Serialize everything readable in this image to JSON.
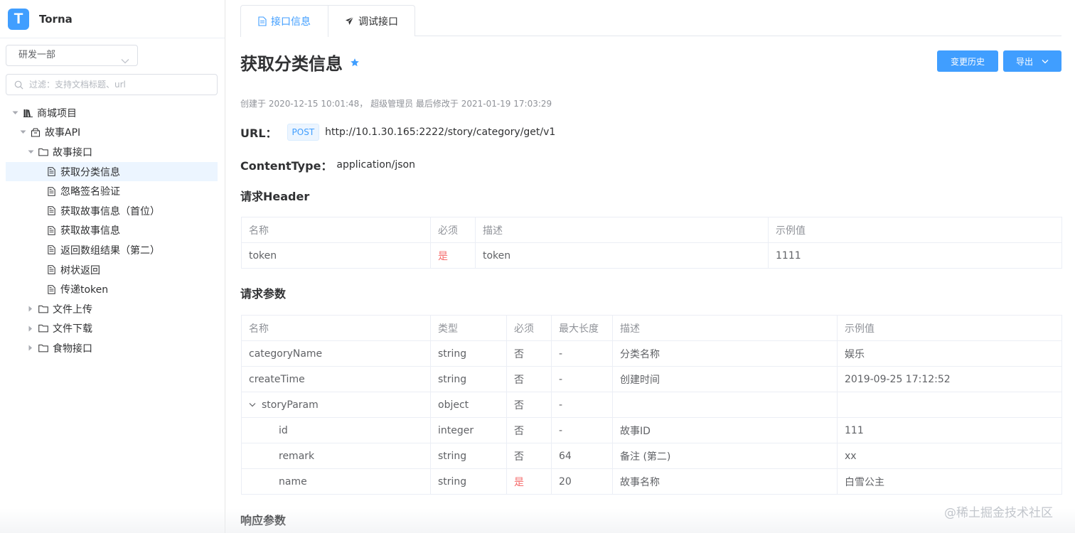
{
  "app": {
    "name": "Torna",
    "logo_letter": "T",
    "accent": "#409eff"
  },
  "sidebar": {
    "space_select": "研发一部",
    "filter_placeholder": "过滤：支持文档标题、url",
    "tree": [
      {
        "label": "商城项目",
        "level": 0,
        "icon": "project-icon",
        "expanded": true
      },
      {
        "label": "故事API",
        "level": 1,
        "icon": "module-icon",
        "expanded": true
      },
      {
        "label": "故事接口",
        "level": 2,
        "icon": "folder-icon",
        "expanded": true
      },
      {
        "label": "获取分类信息",
        "level": 3,
        "icon": "doc-icon",
        "active": true
      },
      {
        "label": "忽略签名验证",
        "level": 3,
        "icon": "doc-icon"
      },
      {
        "label": "获取故事信息（首位）",
        "level": 3,
        "icon": "doc-icon"
      },
      {
        "label": "获取故事信息",
        "level": 3,
        "icon": "doc-icon"
      },
      {
        "label": "返回数组结果（第二）",
        "level": 3,
        "icon": "doc-icon"
      },
      {
        "label": "树状返回",
        "level": 3,
        "icon": "doc-icon"
      },
      {
        "label": "传递token",
        "level": 3,
        "icon": "doc-icon"
      },
      {
        "label": "文件上传",
        "level": 2,
        "icon": "folder-icon",
        "expanded": false
      },
      {
        "label": "文件下载",
        "level": 2,
        "icon": "folder-icon",
        "expanded": false
      },
      {
        "label": "食物接口",
        "level": 2,
        "icon": "folder-icon",
        "expanded": false
      }
    ]
  },
  "tabs": [
    {
      "label": "接口信息",
      "icon": "document-icon",
      "active": true
    },
    {
      "label": "调试接口",
      "icon": "send-icon",
      "active": false
    }
  ],
  "doc": {
    "title": "获取分类信息",
    "favorite_icon": "star-icon",
    "buttons": {
      "history": "变更历史",
      "export": "导出"
    },
    "meta": "创建于 2020-12-15 10:01:48， 超级管理员 最后修改于 2021-01-19 17:03:29",
    "url_label": "URL：",
    "method": "POST",
    "url": "http://10.1.30.165:2222/story/category/get/v1",
    "content_type_label": "ContentType：",
    "content_type": "application/json",
    "header_section": "请求Header",
    "params_section": "请求参数",
    "response_section": "响应参数"
  },
  "header_table": {
    "columns": [
      "名称",
      "必须",
      "描述",
      "示例值"
    ],
    "rows": [
      [
        "token",
        "是",
        "token",
        "1111"
      ]
    ]
  },
  "params_table": {
    "columns": [
      "名称",
      "类型",
      "必须",
      "最大长度",
      "描述",
      "示例值"
    ],
    "rows": [
      [
        "categoryName",
        "string",
        "否",
        "-",
        "分类名称",
        "娱乐"
      ],
      [
        "createTime",
        "string",
        "否",
        "-",
        "创建时间",
        "2019-09-25 17:12:52"
      ],
      [
        "storyParam",
        "object",
        "否",
        "-",
        "",
        ""
      ],
      [
        "id",
        "integer",
        "否",
        "-",
        "故事ID",
        "111"
      ],
      [
        "remark",
        "string",
        "否",
        "64",
        "备注 (第二)",
        "xx"
      ],
      [
        "name",
        "string",
        "是",
        "20",
        "故事名称",
        "白雪公主"
      ]
    ]
  },
  "watermark": "@稀土掘金技术社区"
}
